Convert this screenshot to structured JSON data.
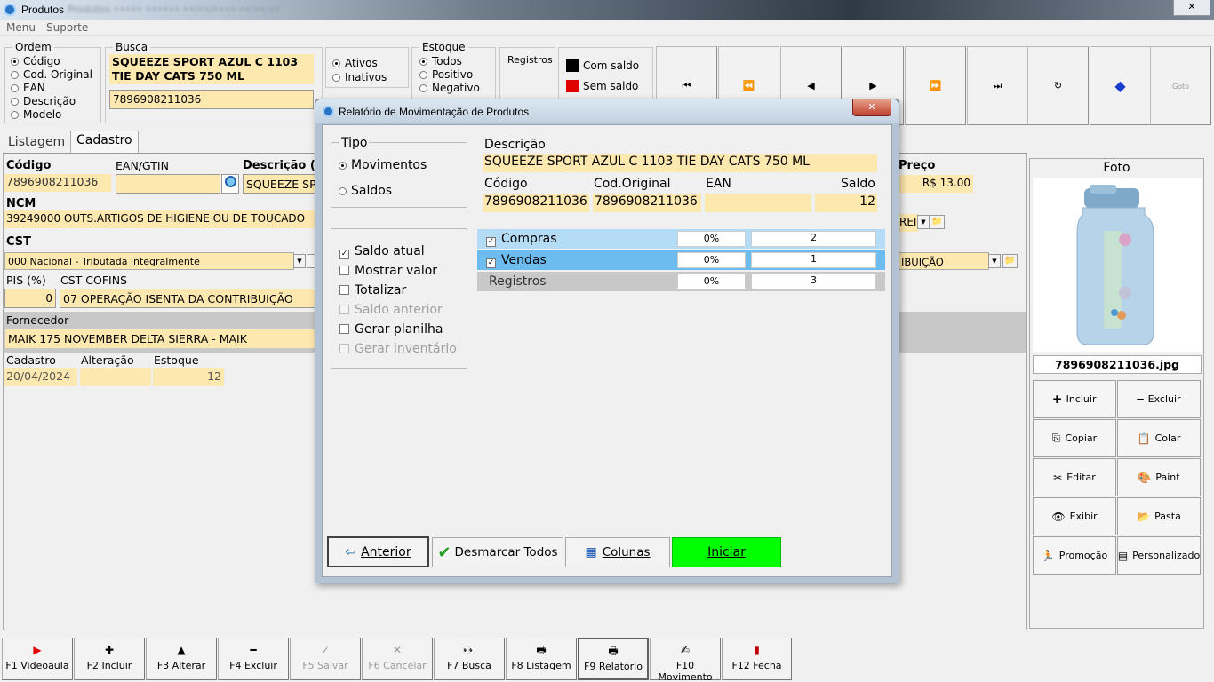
{
  "window": {
    "title": "Produtos",
    "title_blurred": "Produtos   •••••   ••••••  ••/••/••••  ••:••:••",
    "close": "✕"
  },
  "menu": {
    "items": [
      "Menu",
      "Suporte"
    ]
  },
  "ordem": {
    "title": "Ordem",
    "options": [
      "Código",
      "Cod. Original",
      "EAN",
      "Descrição",
      "Modelo"
    ],
    "selected": 0
  },
  "busca": {
    "title": "Busca",
    "line1": "SQUEEZE SPORT AZUL C 1103",
    "line2": "TIE DAY CATS 750 ML",
    "code": "7896908211036"
  },
  "ativos": {
    "options": [
      "Ativos",
      "Inativos"
    ],
    "selected": 0
  },
  "estoque": {
    "title": "Estoque",
    "options": [
      "Todos",
      "Positivo",
      "Negativo"
    ],
    "selected": 0
  },
  "registros": {
    "label": "Registros"
  },
  "legend": [
    {
      "label": "Com saldo",
      "color": "#000000"
    },
    {
      "label": "Sem saldo",
      "color": "#e00000"
    }
  ],
  "tabs": [
    "Listagem",
    "Cadastro"
  ],
  "form": {
    "codigo_label": "Código",
    "codigo": "7896908211036",
    "ean_label": "EAN/GTIN",
    "descricao_label": "Descrição (",
    "descricao": "SQUEEZE SP",
    "preco_label": "Preço",
    "preco": "R$ 13.00",
    "ncm_label": "NCM",
    "ncm": "39249000 OUTS.ARTIGOS DE HIGIENE OU DE TOUCADO",
    "ncm_right": "REI",
    "cst_label": "CST",
    "cst": "000 Nacional - Tributada integralmente",
    "cst_right": "IBUIÇÃO",
    "pis_label": "PIS (%)",
    "pis": "0",
    "cstcofins_label": "CST COFINS",
    "cstcofins": "07 OPERAÇÃO ISENTA DA CONTRIBUIÇÃO",
    "fornecedor_label": "Fornecedor",
    "fornecedor": "MAIK 175 NOVEMBER DELTA SIERRA - MAIK",
    "cadastro_label": "Cadastro",
    "cadastro": "20/04/2024",
    "alteracao_label": "Alteração",
    "alteracao": "",
    "estoque_label": "Estoque",
    "estoque": "12"
  },
  "foto": {
    "title": "Foto",
    "filename": "7896908211036.jpg"
  },
  "right_buttons": [
    {
      "label": "Incluir",
      "icon": "plus-icon",
      "glyph": "✚"
    },
    {
      "label": "Excluir",
      "icon": "minus-icon",
      "glyph": "━"
    },
    {
      "label": "Copiar",
      "icon": "copy-icon",
      "glyph": "⎘"
    },
    {
      "label": "Colar",
      "icon": "paste-icon",
      "glyph": "📋"
    },
    {
      "label": "Editar",
      "icon": "scissors-icon",
      "glyph": "✂"
    },
    {
      "label": "Paint",
      "icon": "palette-icon",
      "glyph": "🎨"
    },
    {
      "label": "Exibir",
      "icon": "eye-icon",
      "glyph": "👁"
    },
    {
      "label": "Pasta",
      "icon": "folder-icon",
      "glyph": "📂"
    },
    {
      "label": "Promoção",
      "icon": "runner-icon",
      "glyph": "🏃"
    },
    {
      "label": "Personalizado",
      "icon": "card-icon",
      "glyph": "▤"
    }
  ],
  "nav_buttons": [
    {
      "name": "first-record-button",
      "glyph": "⏮"
    },
    {
      "name": "prev-page-button",
      "glyph": "⏪"
    },
    {
      "name": "prev-record-button",
      "glyph": "◀"
    },
    {
      "name": "next-record-button",
      "glyph": "▶"
    },
    {
      "name": "next-page-button",
      "glyph": "⏩"
    },
    {
      "name": "last-record-button",
      "glyph": "⏭"
    },
    {
      "name": "refresh-button",
      "glyph": "↻"
    },
    {
      "name": "eraser-button",
      "glyph": "◆"
    },
    {
      "name": "goto-button",
      "glyph": "Goto"
    }
  ],
  "footer": [
    {
      "key": "F1 Videoaula",
      "icon": "youtube-icon",
      "glyph": "▶",
      "disabled": false
    },
    {
      "key": "F2 Incluir",
      "icon": "plus-icon",
      "glyph": "✚",
      "disabled": false
    },
    {
      "key": "F3 Alterar",
      "icon": "up-arrow-icon",
      "glyph": "▲",
      "disabled": false
    },
    {
      "key": "F4 Excluir",
      "icon": "minus-icon",
      "glyph": "━",
      "disabled": false
    },
    {
      "key": "F5 Salvar",
      "icon": "check-icon",
      "glyph": "✓",
      "disabled": true
    },
    {
      "key": "F6 Cancelar",
      "icon": "x-icon",
      "glyph": "✕",
      "disabled": true
    },
    {
      "key": "F7 Busca",
      "icon": "binoculars-icon",
      "glyph": "👀",
      "disabled": false
    },
    {
      "key": "F8 Listagem",
      "icon": "printer-icon",
      "glyph": "🖶",
      "disabled": false
    },
    {
      "key": "F9 Relatório",
      "icon": "printer-icon",
      "glyph": "🖶",
      "disabled": false
    },
    {
      "key": "F10 Movimento",
      "icon": "checklist-icon",
      "glyph": "✍",
      "disabled": false
    },
    {
      "key": "F12 Fecha",
      "icon": "exit-door-icon",
      "glyph": "▮",
      "disabled": false
    }
  ],
  "dialog": {
    "title": "Relatório de Movimentação de Produtos",
    "tipo_title": "Tipo",
    "tipo_options": [
      "Movimentos",
      "Saldos"
    ],
    "tipo_selected": 0,
    "options": [
      {
        "label": "Saldo atual",
        "checked": true,
        "disabled": false
      },
      {
        "label": "Mostrar valor",
        "checked": false,
        "disabled": false
      },
      {
        "label": "Totalizar",
        "checked": false,
        "disabled": false
      },
      {
        "label": "Saldo anterior",
        "checked": false,
        "disabled": true
      },
      {
        "label": "Gerar planilha",
        "checked": false,
        "disabled": false
      },
      {
        "label": "Gerar inventário",
        "checked": false,
        "disabled": true
      }
    ],
    "descricao_label": "Descrição",
    "descricao": "SQUEEZE SPORT AZUL C 1103 TIE DAY CATS 750 ML",
    "codigo_label": "Código",
    "codigo": "7896908211036",
    "codorig_label": "Cod.Original",
    "codorig": "7896908211036",
    "ean_label": "EAN",
    "ean": "",
    "saldo_label": "Saldo",
    "saldo": "12",
    "rows": [
      {
        "label": "Compras",
        "checked": true,
        "pct": "0%",
        "count": "2",
        "bg": "#b4dcf6"
      },
      {
        "label": "Vendas",
        "checked": true,
        "pct": "0%",
        "count": "1",
        "bg": "#6cbcf0"
      },
      {
        "label": "Registros",
        "checked": false,
        "pct": "0%",
        "count": "3",
        "bg": "#c8c8c8"
      }
    ],
    "buttons": {
      "anterior": "Anterior",
      "desmarcar": "Desmarcar Todos",
      "colunas": "Colunas",
      "iniciar": "Iniciar"
    }
  }
}
